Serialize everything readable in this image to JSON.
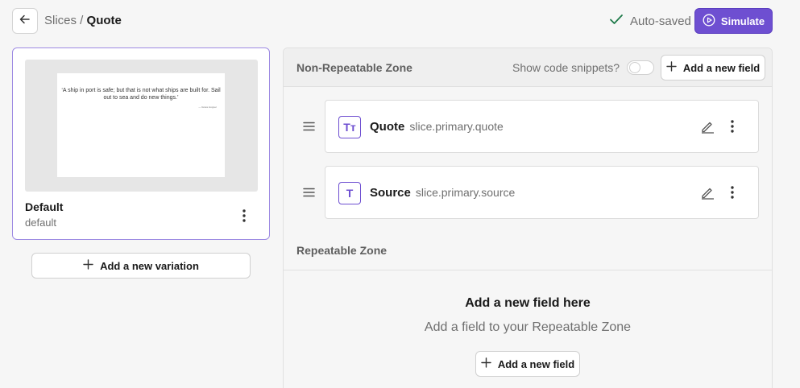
{
  "header": {
    "breadcrumb_parent": "Slices",
    "breadcrumb_sep": " / ",
    "breadcrumb_current": "Quote",
    "autosave_label": "Auto-saved",
    "simulate_label": "Simulate"
  },
  "variation": {
    "name": "Default",
    "id": "default",
    "preview_quote": "‘A ship in port is safe; but that is not what ships are built for. Sail out to sea and do new things.’",
    "preview_author": "— Grace Hopper",
    "add_variation_label": "Add a new variation"
  },
  "non_repeatable": {
    "title": "Non-Repeatable Zone",
    "snippets_label": "Show code snippets?",
    "snippets_enabled": false,
    "add_field_label": "Add a new field",
    "fields": [
      {
        "icon_text": "Tт",
        "icon": "rich-text-icon",
        "label": "Quote",
        "path": "slice.primary.quote"
      },
      {
        "icon_text": "T",
        "icon": "text-icon",
        "label": "Source",
        "path": "slice.primary.source"
      }
    ]
  },
  "repeatable": {
    "title": "Repeatable Zone",
    "empty_title": "Add a new field here",
    "empty_desc": "Add a field to your Repeatable Zone",
    "add_field_label": "Add a new field"
  },
  "colors": {
    "accent": "#6e4fd1",
    "success": "#1f7a4a"
  }
}
